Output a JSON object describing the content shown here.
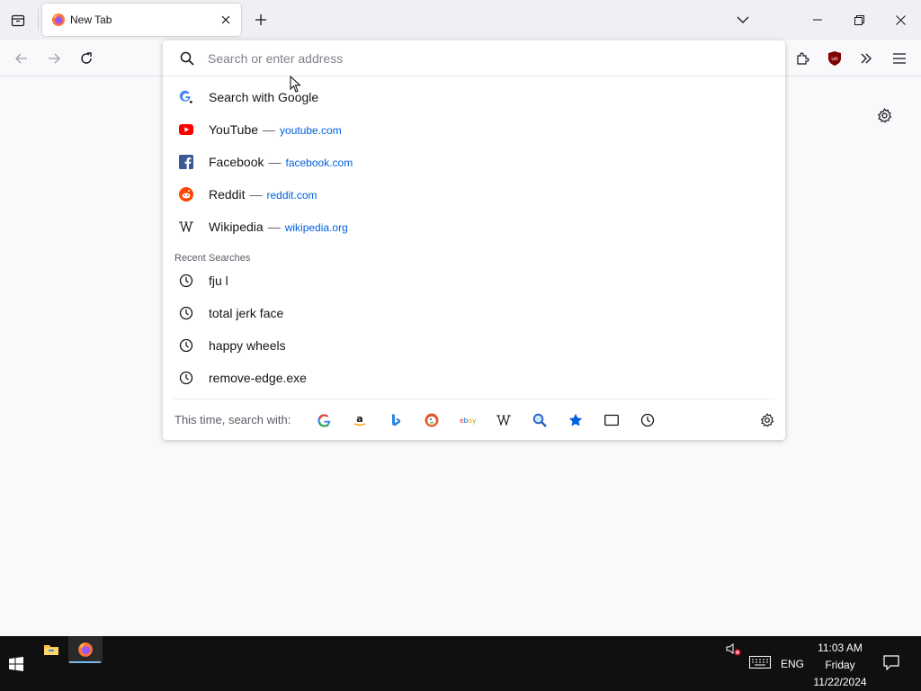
{
  "browser": {
    "tab": {
      "title": "New Tab"
    },
    "urlbar": {
      "placeholder": "Search or enter address",
      "value": ""
    }
  },
  "suggestions": [
    {
      "label": "Search with Google",
      "url": "",
      "icon": "google-search-icon"
    },
    {
      "label": "YouTube",
      "url": "youtube.com",
      "icon": "youtube-icon"
    },
    {
      "label": "Facebook",
      "url": "facebook.com",
      "icon": "facebook-icon"
    },
    {
      "label": "Reddit",
      "url": "reddit.com",
      "icon": "reddit-icon"
    },
    {
      "label": "Wikipedia",
      "url": "wikipedia.org",
      "icon": "wikipedia-icon"
    }
  ],
  "recent_searches": {
    "heading": "Recent Searches",
    "items": [
      "fju l",
      "total jerk face",
      "happy wheels",
      "remove-edge.exe"
    ]
  },
  "oneoff": {
    "label": "This time, search with:",
    "engines": [
      "google",
      "amazon",
      "bing",
      "duckduckgo",
      "ebay",
      "wikipedia",
      "search",
      "bookmarks",
      "tabs",
      "history"
    ]
  },
  "taskbar": {
    "language": "ENG",
    "time": "11:03 AM",
    "day": "Friday",
    "date": "11/22/2024"
  },
  "colors": {
    "accent_link": "#0061e0",
    "taskbar_bg": "#101010",
    "ublock_red": "#800000"
  }
}
